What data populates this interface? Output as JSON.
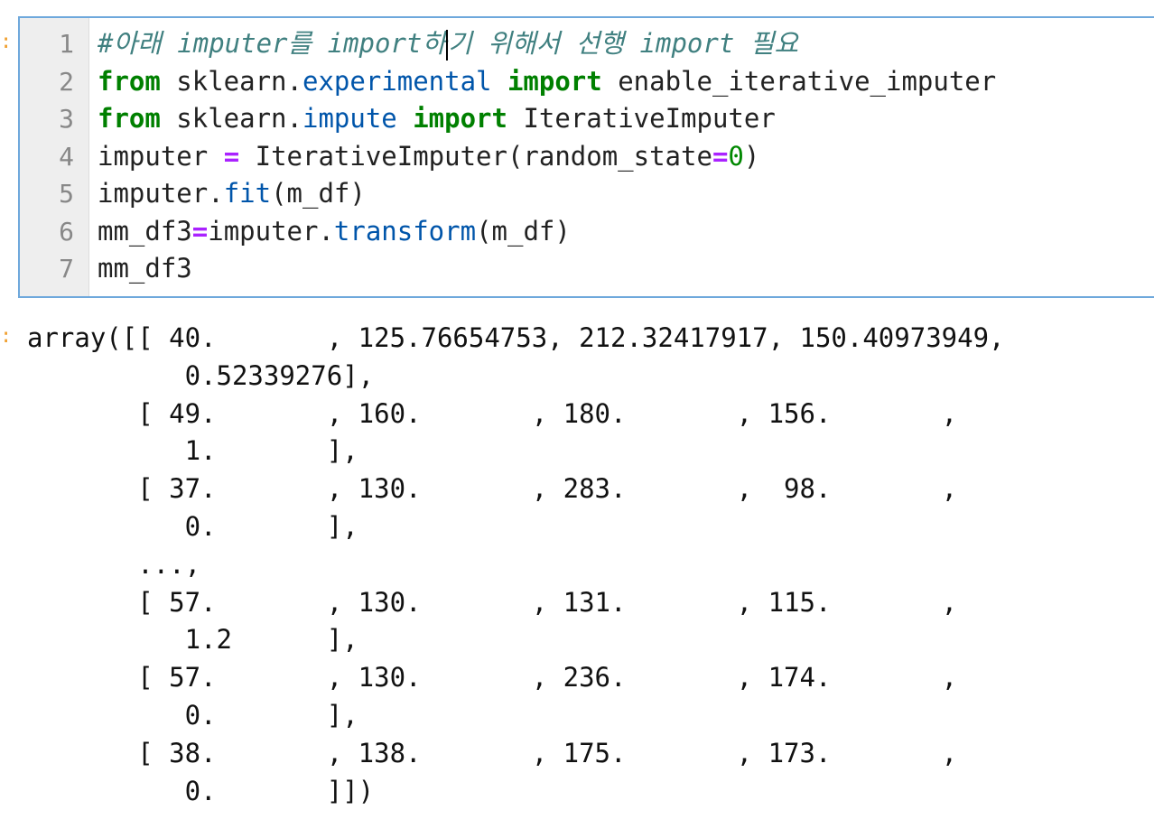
{
  "input_cell": {
    "line_numbers": [
      "1",
      "2",
      "3",
      "4",
      "5",
      "6",
      "7"
    ],
    "lines": [
      [
        {
          "t": "#아래 imputer를 import하",
          "c": "cm-comment"
        },
        {
          "cursor": true
        },
        {
          "t": "기 위해서 선행 import 필요",
          "c": "cm-comment"
        }
      ],
      [
        {
          "t": "from",
          "c": "cm-keyword"
        },
        {
          "t": " sklearn."
        },
        {
          "t": "experimental",
          "c": "cm-property"
        },
        {
          "t": " "
        },
        {
          "t": "import",
          "c": "cm-keyword"
        },
        {
          "t": " enable_iterative_imputer"
        }
      ],
      [
        {
          "t": "from",
          "c": "cm-keyword"
        },
        {
          "t": " sklearn."
        },
        {
          "t": "impute",
          "c": "cm-property"
        },
        {
          "t": " "
        },
        {
          "t": "import",
          "c": "cm-keyword"
        },
        {
          "t": " IterativeImputer"
        }
      ],
      [
        {
          "t": "imputer "
        },
        {
          "t": "=",
          "c": "cm-operator"
        },
        {
          "t": " IterativeImputer(random_state"
        },
        {
          "t": "=",
          "c": "cm-operator"
        },
        {
          "t": "0",
          "c": "cm-number"
        },
        {
          "t": ")"
        }
      ],
      [
        {
          "t": "imputer."
        },
        {
          "t": "fit",
          "c": "cm-property"
        },
        {
          "t": "(m_df)"
        }
      ],
      [
        {
          "t": "mm_df3"
        },
        {
          "t": "=",
          "c": "cm-operator"
        },
        {
          "t": "imputer."
        },
        {
          "t": "transform",
          "c": "cm-property"
        },
        {
          "t": "(m_df)"
        }
      ],
      [
        {
          "t": "mm_df3"
        }
      ]
    ]
  },
  "output_cell": {
    "lines": [
      "array([[ 40.       , 125.76654753, 212.32417917, 150.40973949,",
      "          0.52339276],",
      "       [ 49.       , 160.       , 180.       , 156.       ,",
      "          1.       ],",
      "       [ 37.       , 130.       , 283.       ,  98.       ,",
      "          0.       ],",
      "       ...,",
      "       [ 57.       , 130.       , 131.       , 115.       ,",
      "          1.2      ],",
      "       [ 57.       , 130.       , 236.       , 174.       ,",
      "          0.       ],",
      "       [ 38.       , 138.       , 175.       , 173.       ,",
      "          0.       ]])"
    ]
  }
}
